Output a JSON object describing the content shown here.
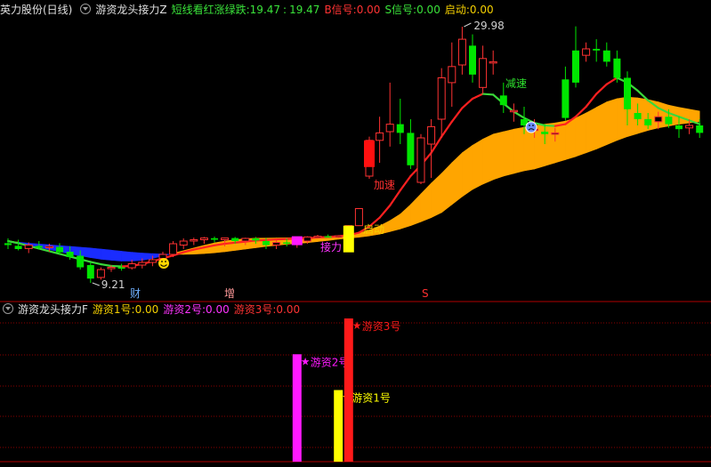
{
  "header_top": {
    "stock_name": "英力股份(日线)",
    "indicator_name": "游资龙头接力Z",
    "legend_label": "短线看红涨绿跌",
    "legend_value_a": "19.47",
    "legend_value_b": "19.47",
    "b_signal_label": "B信号:",
    "b_signal_value": "0.00",
    "s_signal_label": "S信号:",
    "s_signal_value": "0.00",
    "start_label": "启动:",
    "start_value": "0.00"
  },
  "header_bottom": {
    "indicator_name": "游资龙头接力F",
    "hot_money_1_label": "游资1号:",
    "hot_money_1_value": "0.00",
    "hot_money_2_label": "游资2号:",
    "hot_money_2_value": "0.00",
    "hot_money_3_label": "游资3号:",
    "hot_money_3_value": "0.00"
  },
  "colors": {
    "up": "#ff3232",
    "down": "#00e600",
    "ribbon_low": "#1a2cff",
    "ribbon_high": "#ffa500",
    "ma_red": "#ff2020",
    "ma_green": "#3ad83a",
    "gold": "#f5d000",
    "magenta": "#ff19ff",
    "red_bar": "#ff1a1a"
  },
  "chart_data": [
    {
      "type": "candlestick",
      "title": "游资龙头接力Z",
      "candles": [
        {
          "o": 10.82,
          "h": 11.0,
          "l": 10.6,
          "c": 10.75
        },
        {
          "o": 10.72,
          "h": 10.95,
          "l": 10.55,
          "c": 10.6
        },
        {
          "o": 10.62,
          "h": 10.85,
          "l": 10.45,
          "c": 10.75
        },
        {
          "o": 10.72,
          "h": 10.9,
          "l": 10.58,
          "c": 10.65
        },
        {
          "o": 10.66,
          "h": 10.8,
          "l": 10.5,
          "c": 10.7
        },
        {
          "o": 10.68,
          "h": 10.82,
          "l": 10.4,
          "c": 10.48
        },
        {
          "o": 10.5,
          "h": 10.7,
          "l": 10.2,
          "c": 10.3
        },
        {
          "o": 10.35,
          "h": 10.55,
          "l": 9.8,
          "c": 9.9
        },
        {
          "o": 10.0,
          "h": 10.1,
          "l": 9.21,
          "c": 9.4
        },
        {
          "o": 9.45,
          "h": 9.9,
          "l": 9.35,
          "c": 9.8
        },
        {
          "o": 9.85,
          "h": 10.0,
          "l": 9.7,
          "c": 9.9
        },
        {
          "o": 9.9,
          "h": 10.05,
          "l": 9.75,
          "c": 9.85
        },
        {
          "o": 9.88,
          "h": 10.2,
          "l": 9.8,
          "c": 10.05
        },
        {
          "o": 10.0,
          "h": 10.25,
          "l": 9.85,
          "c": 10.1
        },
        {
          "o": 10.1,
          "h": 10.35,
          "l": 9.95,
          "c": 10.2
        },
        {
          "o": 10.25,
          "h": 10.5,
          "l": 10.1,
          "c": 10.4
        },
        {
          "o": 10.4,
          "h": 10.9,
          "l": 10.3,
          "c": 10.8
        },
        {
          "o": 10.75,
          "h": 11.0,
          "l": 10.6,
          "c": 10.9
        },
        {
          "o": 10.9,
          "h": 11.1,
          "l": 10.75,
          "c": 10.95
        },
        {
          "o": 10.95,
          "h": 11.2,
          "l": 10.8,
          "c": 11.05
        },
        {
          "o": 11.02,
          "h": 11.25,
          "l": 10.85,
          "c": 10.95
        },
        {
          "o": 10.95,
          "h": 11.1,
          "l": 10.7,
          "c": 11.05
        },
        {
          "o": 11.05,
          "h": 11.2,
          "l": 10.8,
          "c": 10.9
        },
        {
          "o": 10.9,
          "h": 11.1,
          "l": 10.75,
          "c": 11.0
        },
        {
          "o": 11.0,
          "h": 11.2,
          "l": 10.8,
          "c": 10.92
        },
        {
          "o": 10.9,
          "h": 11.05,
          "l": 10.6,
          "c": 10.75
        },
        {
          "o": 10.75,
          "h": 10.95,
          "l": 10.6,
          "c": 10.85
        },
        {
          "o": 10.85,
          "h": 11.0,
          "l": 10.7,
          "c": 10.8
        },
        {
          "o": 10.8,
          "h": 11.0,
          "l": 10.65,
          "c": 10.9
        },
        {
          "o": 10.9,
          "h": 11.3,
          "l": 10.8,
          "c": 11.2
        },
        {
          "o": 11.2,
          "h": 11.5,
          "l": 11.05,
          "c": 11.3
        },
        {
          "o": 11.3,
          "h": 11.55,
          "l": 11.1,
          "c": 11.2
        },
        {
          "o": 11.2,
          "h": 11.45,
          "l": 11.05,
          "c": 11.35
        },
        {
          "o": 11.35,
          "h": 13.0,
          "l": 11.3,
          "c": 12.95
        },
        {
          "o": 12.95,
          "h": 15.6,
          "l": 12.9,
          "c": 15.55
        },
        {
          "o": 19.2,
          "h": 22.6,
          "l": 18.9,
          "c": 22.3
        },
        {
          "o": 22.3,
          "h": 24.2,
          "l": 20.5,
          "c": 22.9
        },
        {
          "o": 23.0,
          "h": 26.5,
          "l": 21.8,
          "c": 23.6
        },
        {
          "o": 23.6,
          "h": 25.5,
          "l": 22.0,
          "c": 22.9
        },
        {
          "o": 22.9,
          "h": 24.0,
          "l": 20.0,
          "c": 20.3
        },
        {
          "o": 18.5,
          "h": 22.8,
          "l": 18.3,
          "c": 22.5
        },
        {
          "o": 22.0,
          "h": 24.0,
          "l": 19.0,
          "c": 23.4
        },
        {
          "o": 24.0,
          "h": 27.4,
          "l": 22.5,
          "c": 26.8
        },
        {
          "o": 26.5,
          "h": 29.0,
          "l": 25.0,
          "c": 27.5
        },
        {
          "o": 27.6,
          "h": 29.98,
          "l": 27.0,
          "c": 29.2
        },
        {
          "o": 28.8,
          "h": 29.5,
          "l": 26.5,
          "c": 27.0
        },
        {
          "o": 26.2,
          "h": 28.8,
          "l": 25.8,
          "c": 28.0
        },
        {
          "o": 27.8,
          "h": 28.5,
          "l": 27.0,
          "c": 27.8
        },
        {
          "o": 25.7,
          "h": 26.5,
          "l": 24.5,
          "c": 25.1
        },
        {
          "o": 24.6,
          "h": 25.2,
          "l": 23.8,
          "c": 24.7
        },
        {
          "o": 24.0,
          "h": 25.0,
          "l": 22.8,
          "c": 23.5
        },
        {
          "o": 23.2,
          "h": 24.0,
          "l": 22.5,
          "c": 23.2
        },
        {
          "o": 23.0,
          "h": 23.6,
          "l": 22.0,
          "c": 22.8
        },
        {
          "o": 22.8,
          "h": 23.3,
          "l": 22.2,
          "c": 22.9
        },
        {
          "o": 26.7,
          "h": 27.5,
          "l": 23.9,
          "c": 24.1
        },
        {
          "o": 28.5,
          "h": 30.0,
          "l": 26.2,
          "c": 26.5
        },
        {
          "o": 28.2,
          "h": 29.0,
          "l": 27.8,
          "c": 28.6
        },
        {
          "o": 28.6,
          "h": 29.2,
          "l": 27.8,
          "c": 28.5
        },
        {
          "o": 28.5,
          "h": 29.0,
          "l": 27.5,
          "c": 27.8
        },
        {
          "o": 28.0,
          "h": 28.5,
          "l": 26.5,
          "c": 26.8
        },
        {
          "o": 26.8,
          "h": 27.2,
          "l": 23.5,
          "c": 24.8
        },
        {
          "o": 24.5,
          "h": 25.2,
          "l": 23.5,
          "c": 24.0
        },
        {
          "o": 24.0,
          "h": 24.5,
          "l": 23.2,
          "c": 23.5
        },
        {
          "o": 23.8,
          "h": 24.6,
          "l": 23.2,
          "c": 24.2
        },
        {
          "o": 24.2,
          "h": 24.8,
          "l": 23.3,
          "c": 23.6
        },
        {
          "o": 23.5,
          "h": 24.2,
          "l": 22.5,
          "c": 23.2
        },
        {
          "o": 23.3,
          "h": 24.0,
          "l": 22.8,
          "c": 23.5
        },
        {
          "o": 23.5,
          "h": 24.0,
          "l": 22.5,
          "c": 22.9
        }
      ],
      "upper_ma_line": {
        "name": "",
        "colored_by": "trend: red rising, green falling",
        "values": [
          10.9,
          10.82,
          10.72,
          10.62,
          10.52,
          10.42,
          10.32,
          10.22,
          10.12,
          10.03,
          9.96,
          9.94,
          9.96,
          10.04,
          10.14,
          10.25,
          10.36,
          10.48,
          10.58,
          10.66,
          10.74,
          10.8,
          10.84,
          10.88,
          10.92,
          10.94,
          10.96,
          10.98,
          11.0,
          11.04,
          11.12,
          11.2,
          11.3,
          11.45,
          11.8,
          12.8,
          14.3,
          15.9,
          17.6,
          19.2,
          20.3,
          21.3,
          22.6,
          23.8,
          24.9,
          25.5,
          25.8,
          25.75,
          25.2,
          24.6,
          24.1,
          23.7,
          23.5,
          23.45,
          23.6,
          24.2,
          25.0,
          25.8,
          26.4,
          26.8,
          26.5,
          26.0,
          25.4,
          24.9,
          24.5,
          24.2,
          23.9,
          23.6
        ]
      },
      "ribbon": {
        "low_color": "blue",
        "high_color": "orange",
        "line_a": [
          10.92,
          10.85,
          10.76,
          10.67,
          10.58,
          10.5,
          10.42,
          10.35,
          10.28,
          10.22,
          10.18,
          10.15,
          10.15,
          10.18,
          10.25,
          10.34,
          10.44,
          10.54,
          10.64,
          10.74,
          10.83,
          10.9,
          10.95,
          10.99,
          11.02,
          11.04,
          11.06,
          11.08,
          11.1,
          11.12,
          11.16,
          11.22,
          11.32,
          11.48,
          11.75,
          12.2,
          12.9,
          13.8,
          14.9,
          16.0,
          17.2,
          18.4,
          19.5,
          20.5,
          21.3,
          21.9,
          22.4,
          22.8,
          23.0,
          23.2,
          23.35,
          23.5,
          23.6,
          23.7,
          23.85,
          24.1,
          24.5,
          24.95,
          25.3,
          25.5,
          25.6,
          25.55,
          25.45,
          25.3,
          25.1,
          24.95,
          24.8,
          24.65
        ],
        "line_b": [
          10.9,
          10.86,
          10.82,
          10.79,
          10.76,
          10.73,
          10.7,
          10.67,
          10.64,
          10.6,
          10.56,
          10.52,
          10.48,
          10.45,
          10.43,
          10.41,
          10.4,
          10.4,
          10.41,
          10.43,
          10.46,
          10.5,
          10.55,
          10.6,
          10.65,
          10.7,
          10.74,
          10.78,
          10.81,
          10.84,
          10.88,
          10.92,
          10.97,
          11.04,
          11.16,
          11.35,
          11.6,
          11.95,
          12.4,
          12.95,
          13.6,
          14.3,
          15.1,
          16.0,
          16.9,
          17.7,
          18.3,
          18.8,
          19.2,
          19.5,
          19.8,
          20.0,
          20.25,
          20.5,
          20.75,
          21.0,
          21.3,
          21.6,
          21.95,
          22.3,
          22.6,
          22.85,
          23.1,
          23.3,
          23.45,
          23.6,
          23.7,
          23.8
        ]
      },
      "annotations": {
        "high_label": "29.98",
        "low_label": "9.21",
        "accelerate": "加速",
        "slowdown": "减速",
        "start": "启动",
        "relay": "接力",
        "marker_cai": "财",
        "marker_zeng": "增",
        "marker_s": "S"
      },
      "signal_bars": [
        {
          "index": 33,
          "color": "yellow",
          "value": 12.95
        },
        {
          "index": 35,
          "color": "red",
          "value": 22.3
        },
        {
          "index": 28,
          "color": "magenta",
          "value": 11.3
        }
      ]
    },
    {
      "type": "bar",
      "title": "游资龙头接力F",
      "categories": [
        "游资2号",
        "游资1号",
        "游资3号"
      ],
      "series": [
        {
          "name": "游资2号",
          "values": [
            0.75
          ],
          "color": "magenta"
        },
        {
          "name": "游资1号",
          "values": [
            0.5
          ],
          "color": "yellow"
        },
        {
          "name": "游资3号",
          "values": [
            1.0
          ],
          "color": "red"
        }
      ],
      "candle_index": [
        28,
        32,
        33
      ],
      "ylim": [
        0,
        1
      ]
    }
  ]
}
